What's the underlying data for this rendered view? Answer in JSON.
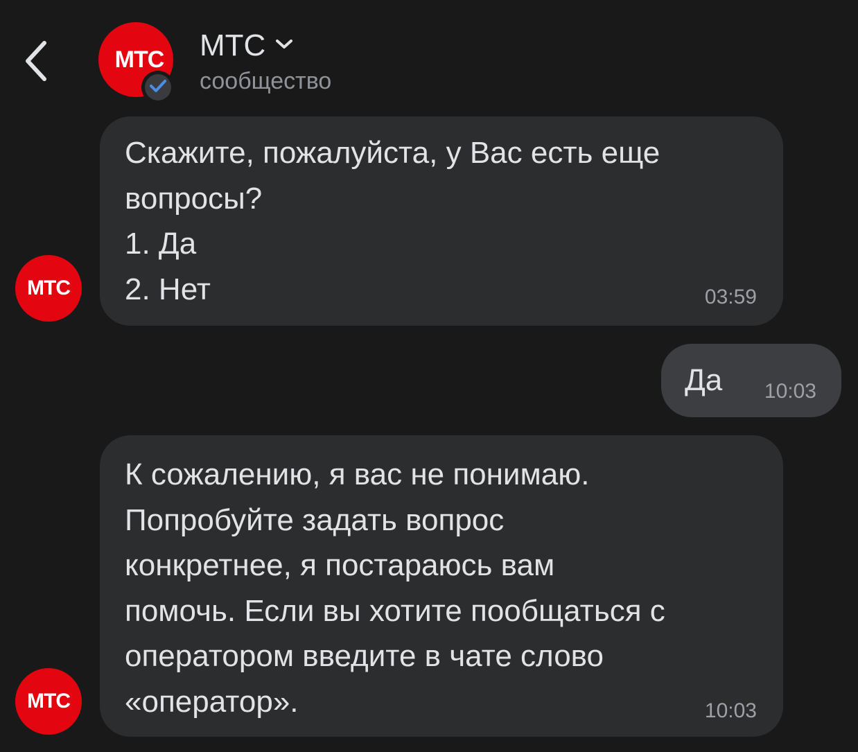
{
  "header": {
    "title": "МТС",
    "subtitle": "сообщество",
    "avatar_logo": "МТС",
    "icons": {
      "back": "chevron-left-icon",
      "title_dropdown": "chevron-down-icon",
      "verified": "verified-check-icon"
    }
  },
  "messages": [
    {
      "direction": "incoming",
      "avatar_logo": "МТС",
      "text": "Скажите, пожалуйста, у Вас есть еще\nвопросы?\n1. Да\n2. Нет",
      "time": "03:59"
    },
    {
      "direction": "outgoing",
      "text": "Да",
      "time": "10:03"
    },
    {
      "direction": "incoming",
      "avatar_logo": "МТС",
      "text": "К сожалению, я вас не понимаю.\nПопробуйте задать вопрос\nконкретнее, я постараюсь вам\nпомочь. Если вы хотите пообщаться с\nоператором введите в чате слово\n«оператор».",
      "time": "10:03"
    }
  ],
  "colors": {
    "background": "#19191a",
    "bubble_incoming": "#2c2d2e",
    "bubble_outgoing": "#3d3e41",
    "brand_red": "#e30611",
    "verified_blue": "#4a8fe7",
    "text_primary": "#e1e3e6",
    "text_secondary": "#8f9399"
  }
}
